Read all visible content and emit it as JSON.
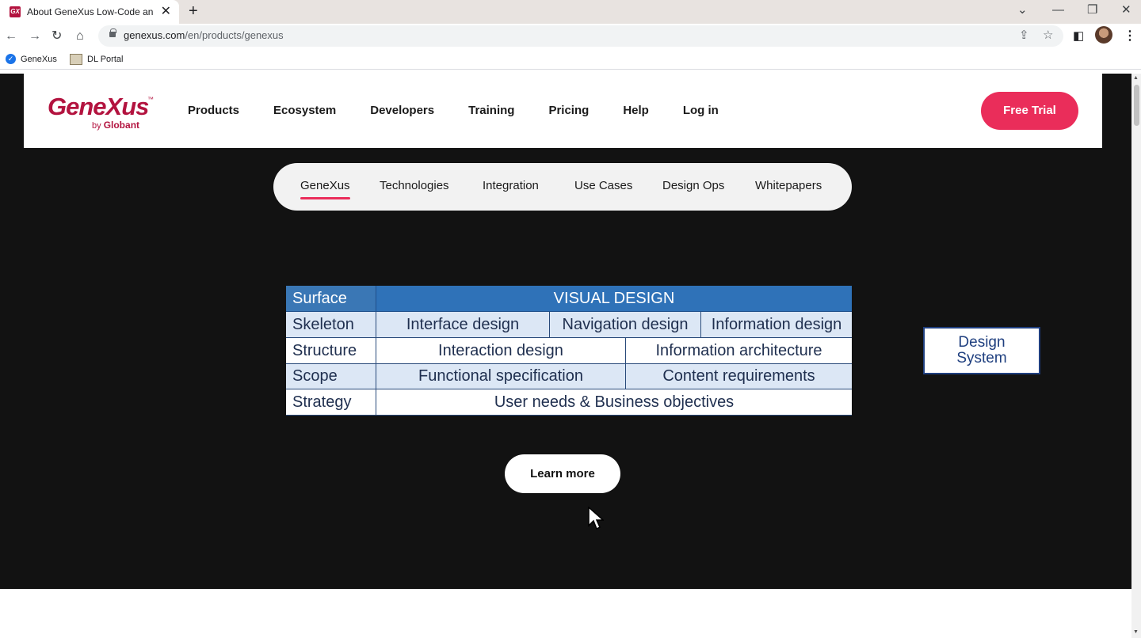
{
  "browser": {
    "tab_title": "About GeneXus Low-Code and M",
    "tab_favicon": "GX",
    "url_domain": "genexus.com",
    "url_path": "/en/products/genexus",
    "bookmarks": [
      {
        "label": "GeneXus",
        "icon": "check-circle-icon"
      },
      {
        "label": "DL Portal",
        "icon": "portal-image-icon"
      }
    ]
  },
  "site": {
    "logo_text": "GeneXus",
    "logo_tm": "™",
    "logo_by": "by",
    "logo_company": "Globant",
    "nav": [
      "Products",
      "Ecosystem",
      "Developers",
      "Training",
      "Pricing",
      "Help",
      "Log in"
    ],
    "cta_label": "Free Trial",
    "subnav": [
      "GeneXus",
      "Technologies",
      "Integration",
      "Use Cases",
      "Design Ops",
      "Whitepapers"
    ],
    "subnav_active": "GeneXus",
    "learn_more_label": "Learn more",
    "colors": {
      "brand": "#b3133f",
      "cta": "#ea2d5a",
      "dark_bg": "#121212",
      "diagram_blue": "#2f72b8"
    }
  },
  "diagram": {
    "rows": [
      {
        "label": "Surface",
        "cells": [
          "VISUAL DESIGN"
        ]
      },
      {
        "label": "Skeleton",
        "cells": [
          "Interface design",
          "Navigation design",
          "Information design"
        ]
      },
      {
        "label": "Structure",
        "cells": [
          "Interaction design",
          "Information architecture"
        ]
      },
      {
        "label": "Scope",
        "cells": [
          "Functional specification",
          "Content requirements"
        ]
      },
      {
        "label": "Strategy",
        "cells": [
          "User needs & Business objectives"
        ]
      }
    ],
    "side_box": {
      "line1": "Design",
      "line2": "System"
    }
  }
}
